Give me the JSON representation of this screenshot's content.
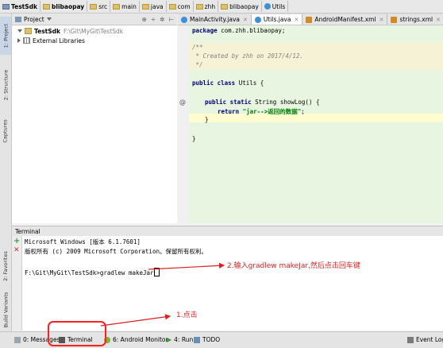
{
  "breadcrumb": [
    "TestSdk",
    "blibaopay",
    "src",
    "main",
    "java",
    "com",
    "zhh",
    "blibaopay",
    "Utils"
  ],
  "sidebar_left": {
    "project": "1: Project",
    "structure": "2: Structure",
    "captures": "Captures",
    "favorites": "2: Favorites",
    "build_variants": "Build Variants"
  },
  "project_panel": {
    "title": "Project",
    "root_name": "TestSdk",
    "root_path": "F:\\Git\\MyGit\\TestSdk",
    "external": "External Libraries"
  },
  "editor_tabs": [
    {
      "label": "MainActivity.java",
      "color": "#3d8fd8"
    },
    {
      "label": "Utils.java",
      "color": "#3d8fd8"
    },
    {
      "label": "AndroidManifest.xml",
      "color": "#d08a2a"
    },
    {
      "label": "strings.xml",
      "color": "#d08a2a"
    }
  ],
  "code": {
    "package_kw": "package",
    "package_name": " com.zhh.blibaopay;",
    "c1": "/**",
    "c2": " * Created by zhh on 2017/4/12.",
    "c3": " */",
    "class_kw": "public class",
    "class_name": " Utils {",
    "method_kw": "public static",
    "method_rest": " String showLog() {",
    "return_kw": "return",
    "return_str": " \"jar-->返回的数据\"",
    "return_end": ";",
    "brace_close1": "}",
    "brace_close2": "}"
  },
  "terminal": {
    "title": "Terminal",
    "line1": "Microsoft Windows [版本 6.1.7601]",
    "line2": "版权所有 (c) 2009 Microsoft Corporation。保留所有权利。",
    "prompt": "F:\\Git\\MyGit\\TestSdk>gradlew makeJar"
  },
  "annotations": {
    "step1": "1.点击",
    "step2": "2.输入gradlew makeJar,然后点击回车键",
    "accent": "#e02020"
  },
  "bottom_tabs": {
    "messages": "0: Messages",
    "terminal": "Terminal",
    "android_monitor": "6: Android Monitor",
    "run": "4: Run",
    "todo": "TODO",
    "event_log": "Event Log"
  }
}
